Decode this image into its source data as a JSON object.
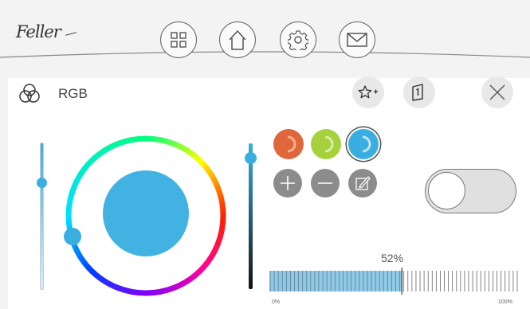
{
  "header": {
    "logo_text": "Feller",
    "nav": [
      {
        "id": "grid",
        "icon": "grid-icon"
      },
      {
        "id": "home",
        "icon": "home-icon"
      },
      {
        "id": "settings",
        "icon": "gear-icon"
      },
      {
        "id": "messages",
        "icon": "mail-icon"
      }
    ]
  },
  "panel": {
    "title": "RGB",
    "title_icon": "rgb-circles-icon",
    "actions": [
      {
        "id": "favorite-add",
        "icon": "star-plus-icon"
      },
      {
        "id": "scene",
        "icon": "scene-1-icon"
      },
      {
        "id": "close",
        "icon": "close-icon"
      }
    ]
  },
  "color": {
    "selected_hex": "#42b2e2",
    "hue_thumb_color": "#3aaee0",
    "accent": "#3aaee0"
  },
  "sliders": {
    "saturation_level": 0.73,
    "brightness_level": 0.9
  },
  "presets": [
    {
      "color": "#e0663b",
      "arc": "#f7b18f"
    },
    {
      "color": "#a5d23c",
      "arc": "#dceaa8"
    },
    {
      "color": "#3aaee0",
      "arc": "#bfe3f3",
      "selected": true
    }
  ],
  "preset_actions": [
    {
      "id": "add",
      "icon": "plus-icon"
    },
    {
      "id": "remove",
      "icon": "minus-icon"
    },
    {
      "id": "edit",
      "icon": "edit-icon"
    }
  ],
  "power_toggle": {
    "on": false
  },
  "dimmer": {
    "value_label": "52%",
    "value": 52,
    "min_label": "0%",
    "max_label": "100%"
  }
}
